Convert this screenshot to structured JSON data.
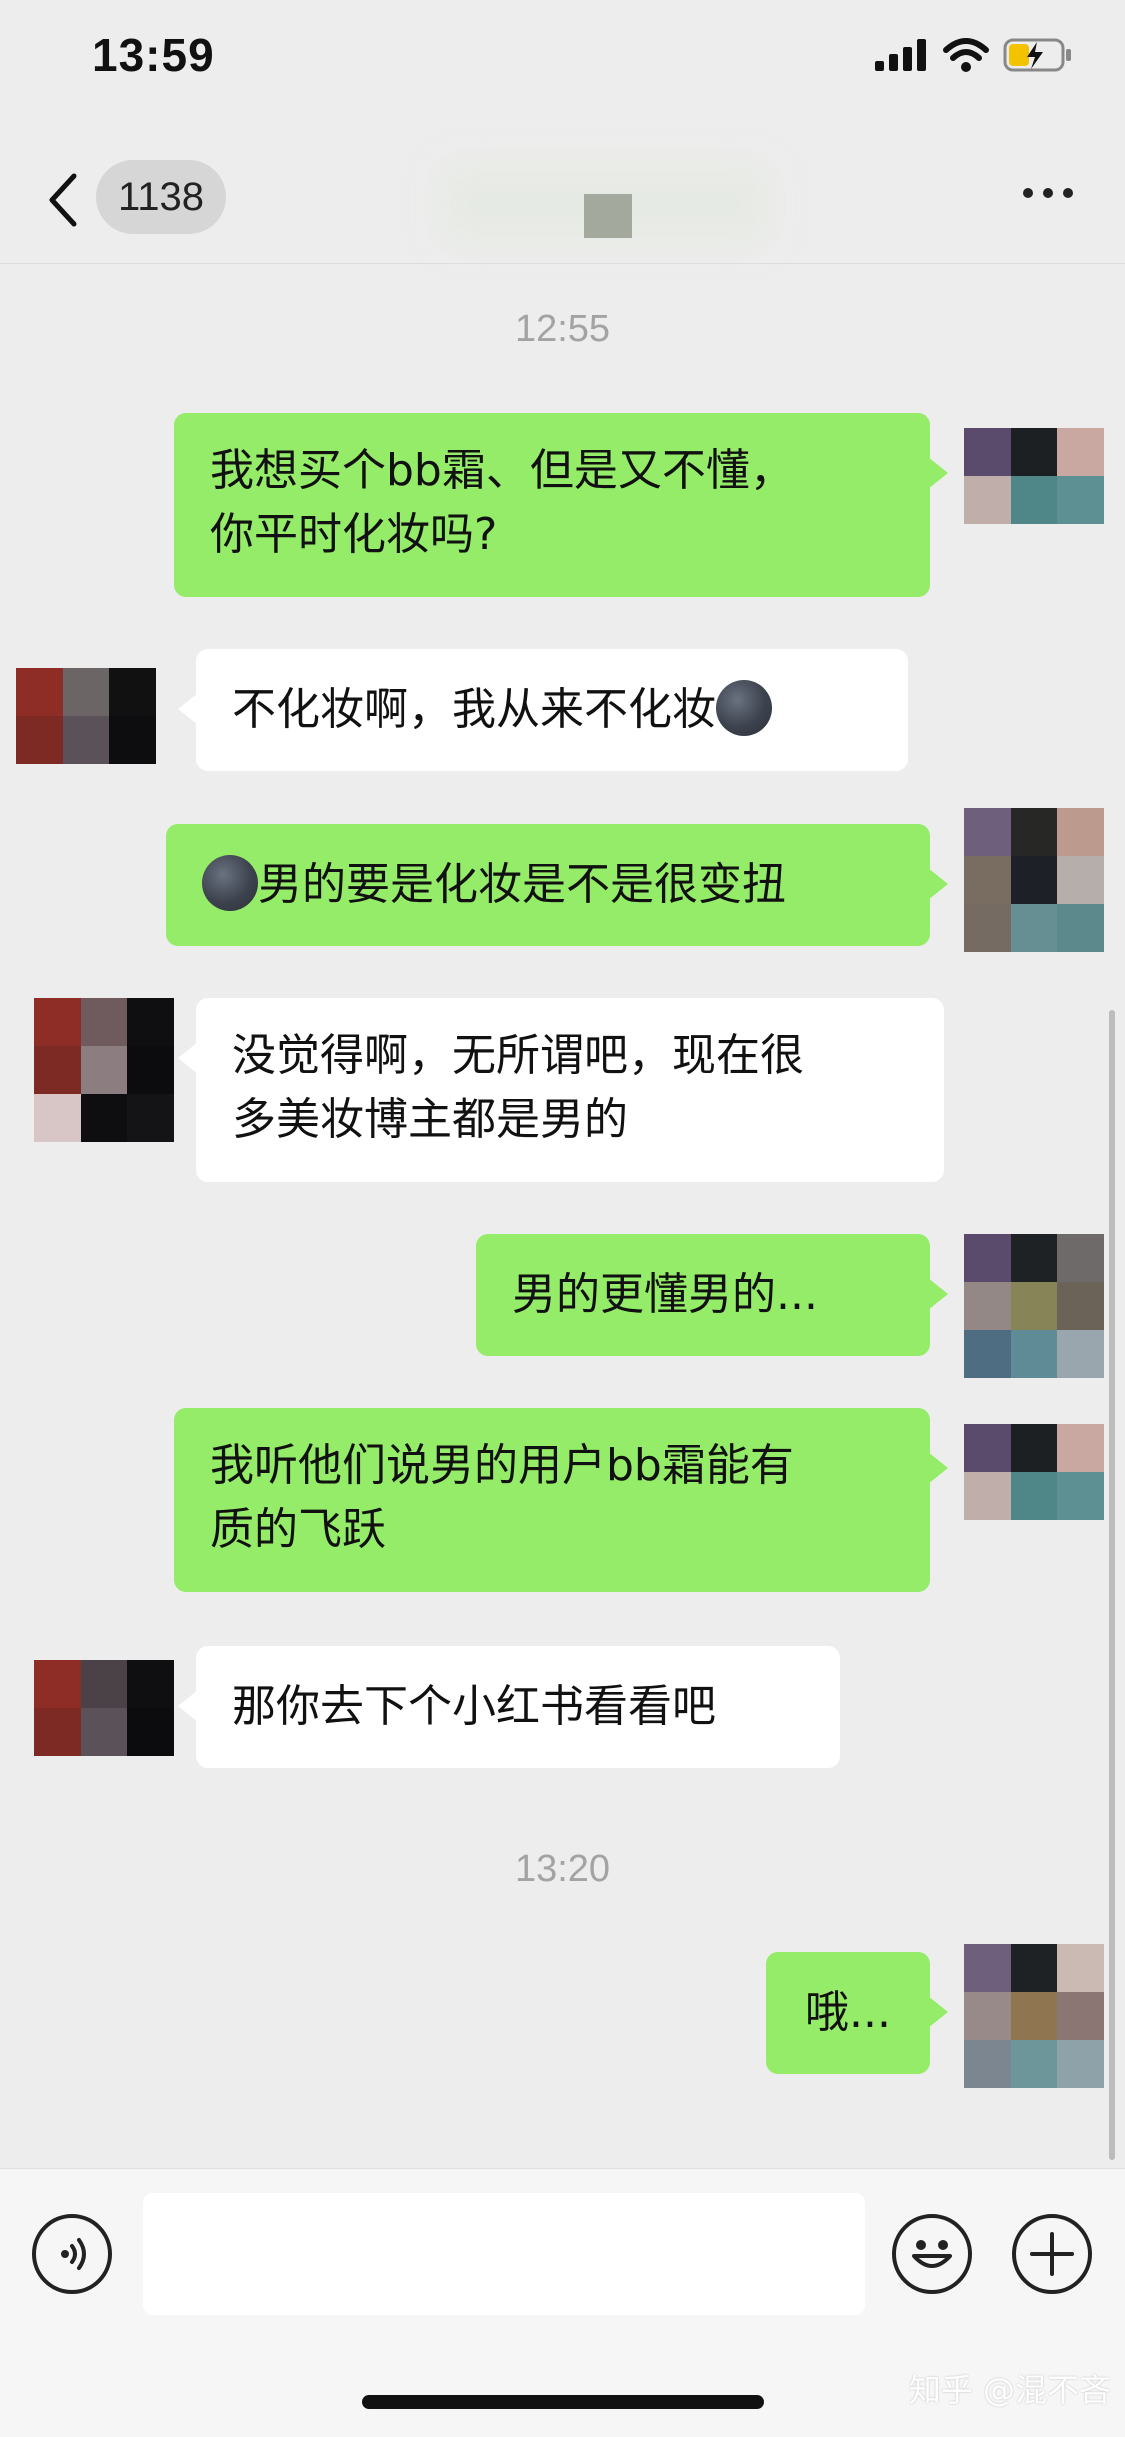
{
  "status_bar": {
    "time": "13:59"
  },
  "nav": {
    "unread_count": "1138"
  },
  "timestamps": [
    "12:55",
    "13:20"
  ],
  "messages": [
    {
      "from": "me",
      "text": "我想买个bb霜、但是又不懂，\n你平时化妆吗?"
    },
    {
      "from": "other",
      "text": "不化妆啊，我从来不化妆",
      "emoji": "new-moon-face-emoji"
    },
    {
      "from": "me",
      "text": "男的要是化妆是不是很变扭",
      "emoji": "new-moon-face-emoji"
    },
    {
      "from": "other",
      "text": "没觉得啊，无所谓吧，现在很\n多美妆博主都是男的"
    },
    {
      "from": "me",
      "text": "男的更懂男的..."
    },
    {
      "from": "me",
      "text": "我听他们说男的用户bb霜能有\n质的飞跃"
    },
    {
      "from": "other",
      "text": "那你去下个小红书看看吧"
    },
    {
      "from": "me",
      "text": "哦..."
    }
  ],
  "input_bar": {
    "placeholder": ""
  },
  "watermark": "知乎 @混不吝",
  "colors": {
    "my_bubble": "#95ec69",
    "other_bubble": "#ffffff",
    "background": "#ededed",
    "timestamp": "#a3a3a3"
  }
}
